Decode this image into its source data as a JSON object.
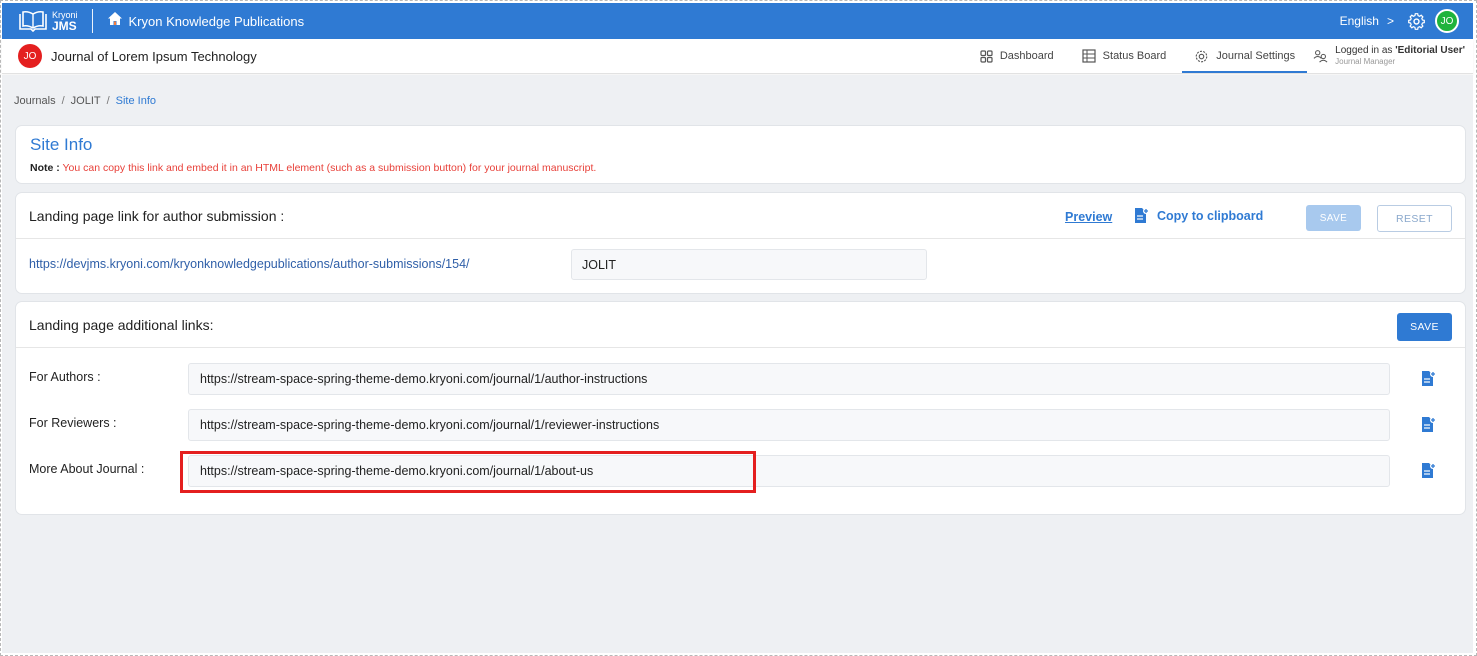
{
  "topbar": {
    "logo_line1": "Kryoni",
    "logo_line2": "JMS",
    "org_name": "Kryon Knowledge Publications",
    "language": "English",
    "language_chevron": ">",
    "avatar": "JO",
    "icons": [
      "book-logo-icon",
      "home-icon",
      "gear-icon",
      "chevron-right-icon"
    ]
  },
  "navbar": {
    "journal_badge": "JO",
    "journal_name": "Journal of Lorem Ipsum Technology",
    "items": [
      {
        "label": "Dashboard",
        "icon": "grid-icon"
      },
      {
        "label": "Status Board",
        "icon": "board-icon"
      },
      {
        "label": "Journal Settings",
        "icon": "gear-icon",
        "active": true
      }
    ],
    "user": {
      "logged_in_prefix": "Logged in as ",
      "user_name": "'Editorial User'",
      "role": "Journal Manager"
    }
  },
  "breadcrumb": {
    "items": [
      "Journals",
      "JOLIT",
      "Site Info"
    ],
    "separator": "/"
  },
  "site_info": {
    "title": "Site Info",
    "note_label": "Note :",
    "note_text": "You can copy this link and embed it in an HTML element (such as a submission button) for your journal manuscript."
  },
  "landing": {
    "title": "Landing page link for author submission :",
    "preview_label": "Preview",
    "copy_label": "Copy to clipboard",
    "save_label": "SAVE",
    "reset_label": "RESET",
    "url_prefix": "https://devjms.kryoni.com/kryonknowledgepublications/author-submissions/154/",
    "slug_value": "JOLIT"
  },
  "additional": {
    "title": "Landing page additional links:",
    "save_label": "SAVE",
    "links": [
      {
        "label": "For Authors :",
        "value": "https://stream-space-spring-theme-demo.kryoni.com/journal/1/author-instructions"
      },
      {
        "label": "For Reviewers :",
        "value": "https://stream-space-spring-theme-demo.kryoni.com/journal/1/reviewer-instructions"
      },
      {
        "label": "More About Journal :",
        "value": "https://stream-space-spring-theme-demo.kryoni.com/journal/1/about-us"
      }
    ]
  },
  "colors": {
    "primary": "#2f7ad3",
    "badge_red": "#e41f1f",
    "avatar_green": "#1fb33c",
    "note_red": "#e8413a",
    "highlight": "#e41f1f"
  }
}
